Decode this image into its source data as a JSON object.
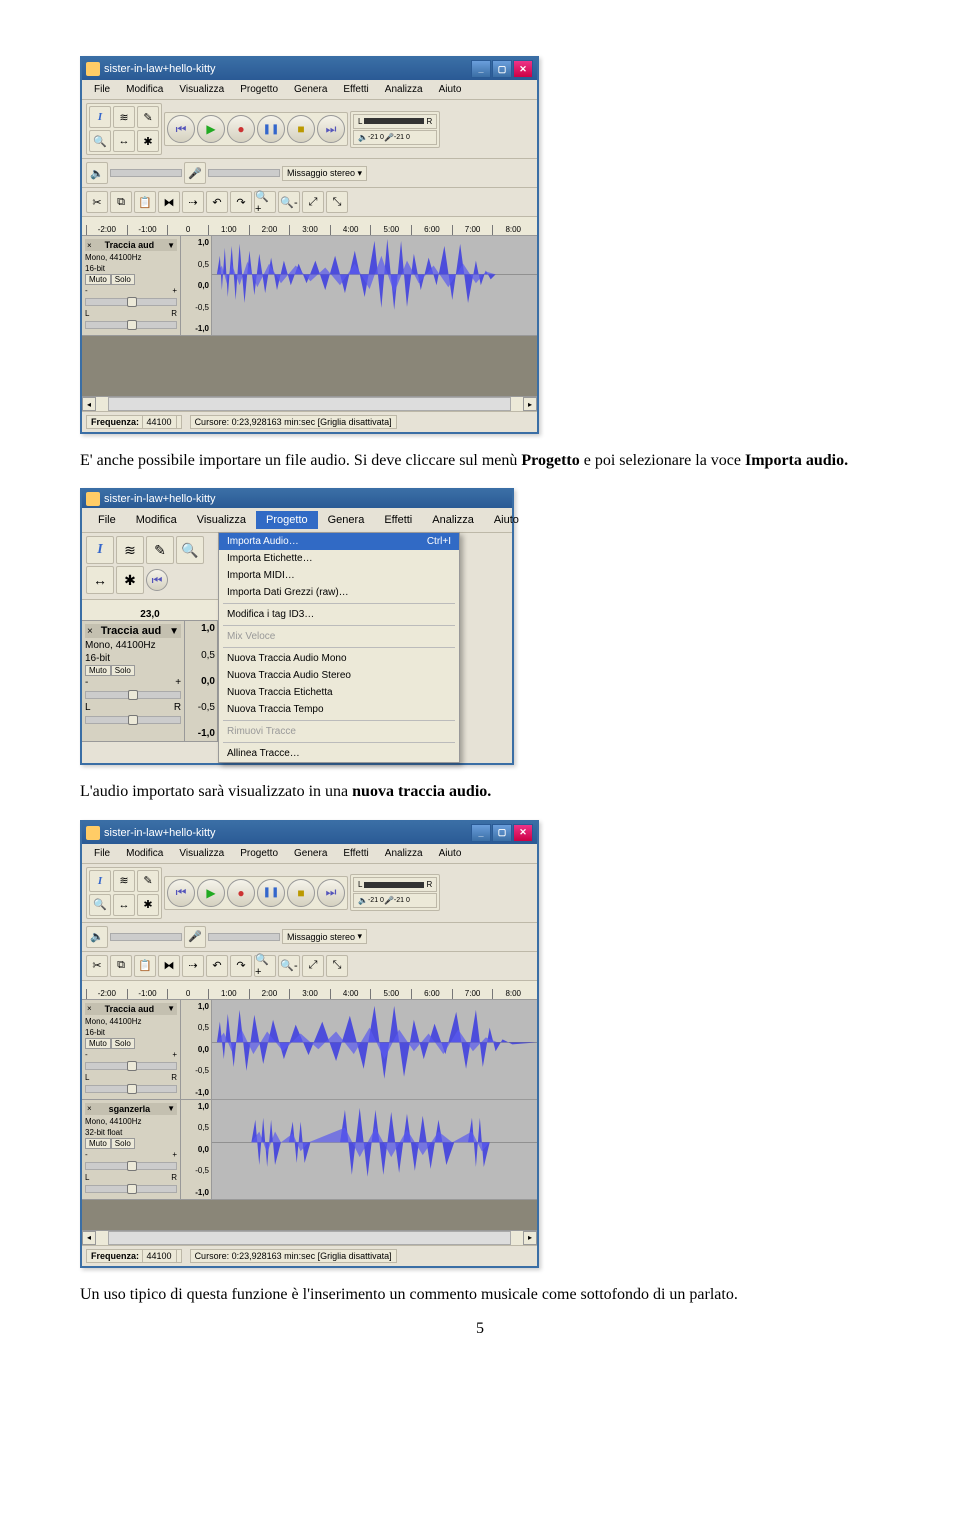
{
  "page_number": "5",
  "paragraphs": {
    "p1_a": "E' anche possibile importare un file audio. Si deve cliccare sul menù ",
    "p1_bold1": "Progetto",
    "p1_b": " e poi selezionare la voce ",
    "p1_bold2": "Importa audio.",
    "p2_a": "L'audio importato sarà visualizzato in una ",
    "p2_bold": "nuova traccia audio.",
    "p3": "Un uso tipico di questa funzione è l'inserimento un commento musicale come sottofondo di un parlato."
  },
  "app": {
    "title": "sister-in-law+hello-kitty",
    "menu": [
      "File",
      "Modifica",
      "Visualizza",
      "Progetto",
      "Genera",
      "Effetti",
      "Analizza",
      "Aiuto"
    ],
    "tools": {
      "selection": "I",
      "envelope": "≋",
      "draw": "✎",
      "zoom": "🔍",
      "timeshift": "↔",
      "multi": "✱"
    },
    "transport": {
      "start": "⏮",
      "play": "▶",
      "record": "●",
      "pause": "❚❚",
      "stop": "■",
      "end": "⏭"
    },
    "meters": {
      "L": "L",
      "R": "R",
      "db": "-21  0"
    },
    "mix_label": "Missaggio stereo",
    "vol_icon": "🔈",
    "ruler_full": [
      "-2:00",
      "-1:00",
      "0",
      "1:00",
      "2:00",
      "3:00",
      "4:00",
      "5:00",
      "6:00",
      "7:00",
      "8:00"
    ],
    "ruler_short": "23,0",
    "track": {
      "close": "×",
      "title": "Traccia aud",
      "drop": "▼",
      "info": "Mono, 44100Hz",
      "bits": "16-bit",
      "bits32": "32-bit float",
      "mute": "Muto",
      "solo": "Solo",
      "L": "L",
      "R": "R",
      "minus": "-",
      "plus": "+"
    },
    "track2_title": "sganzerla",
    "scale": [
      "1,0",
      "0,5",
      "0,0",
      "-0,5",
      "-1,0"
    ],
    "status": {
      "freq_label": "Frequenza:",
      "freq": "44100",
      "cursor": "Cursore: 0:23,928163 min:sec  [Griglia disattivata]"
    },
    "dropdown": {
      "importa_audio": "Importa Audio…",
      "shortcut": "Ctrl+I",
      "importa_etichette": "Importa Etichette…",
      "importa_midi": "Importa MIDI…",
      "importa_raw": "Importa Dati Grezzi (raw)…",
      "mod_tag": "Modifica i tag ID3…",
      "mix_veloce": "Mix Veloce",
      "nt_mono": "Nuova Traccia Audio Mono",
      "nt_stereo": "Nuova Traccia Audio Stereo",
      "nt_etic": "Nuova Traccia Etichetta",
      "nt_tempo": "Nuova Traccia Tempo",
      "rimuovi": "Rimuovi Tracce",
      "allinea": "Allinea Tracce…"
    }
  }
}
